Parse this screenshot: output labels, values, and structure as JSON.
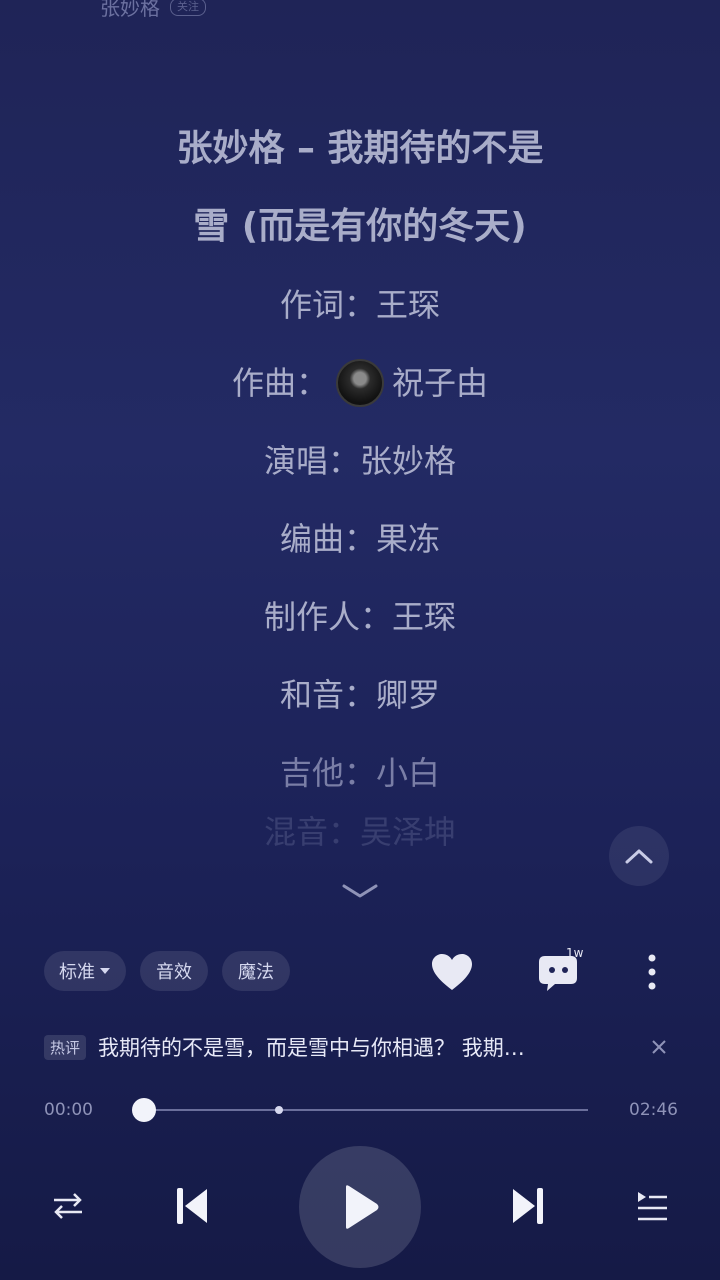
{
  "header": {
    "artist": "张妙格",
    "follow_label": "关注"
  },
  "lyrics": {
    "title_line1": "张妙格 – 我期待的不是",
    "title_line2": "雪 (而是有你的冬天)",
    "lines": [
      "作词：王琛",
      "作曲：",
      "祝子由",
      "演唱：张妙格",
      "编曲：果冻",
      "制作人：王琛",
      "和音：卿罗",
      "吉他：小白",
      "混音：吴泽坤"
    ]
  },
  "controls": {
    "quality_label": "标准",
    "effects_label": "音效",
    "magic_label": "魔法",
    "comment_count_badge": "1w",
    "icons": [
      "heart-icon",
      "comment-icon",
      "more-icon",
      "chevron-up-icon",
      "chevron-down-icon",
      "shuffle-icon",
      "prev-icon",
      "play-icon",
      "next-icon",
      "playlist-icon",
      "close-icon"
    ]
  },
  "hot_comment": {
    "tag": "热评",
    "text": "我期待的不是雪，而是雪中与你相遇？ 我期…"
  },
  "player": {
    "current_time": "00:00",
    "total_time": "02:46",
    "progress": 0.0,
    "buffered": 0.3
  },
  "colors": {
    "background_top": "#1f2457",
    "background_bottom": "#151a46",
    "text": "#a9adc9"
  }
}
